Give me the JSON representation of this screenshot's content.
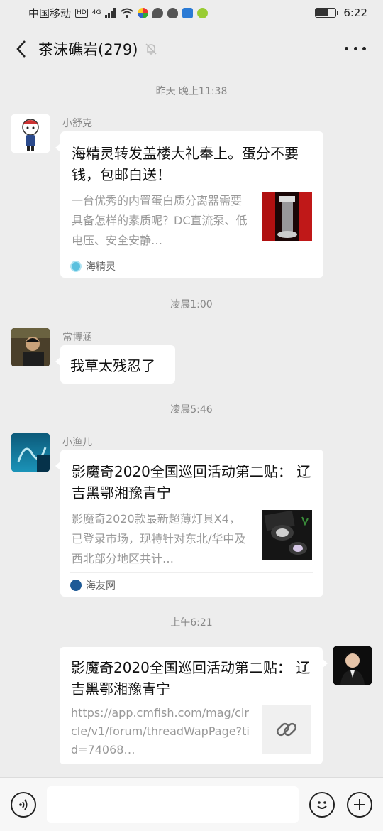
{
  "status_bar": {
    "carrier": "中国移动",
    "hd": "HD",
    "network": "4G",
    "time": "6:22",
    "battery_level": 0.55
  },
  "nav": {
    "title": "茶沫礁岩(279)",
    "back_icon": "chevron-left-icon",
    "mute_icon": "bell-off-icon",
    "more_icon": "more-dots-icon"
  },
  "messages": [
    {
      "timestamp": "昨天 晚上11:38",
      "sender": "小舒克",
      "type": "card",
      "title": "海精灵转发盖楼大礼奉上。蛋分不要钱，包邮白送！",
      "description": "一台优秀的内置蛋白质分离器需要具备怎样的素质呢？DC直流泵、低电压、安全安静…",
      "source": "海精灵"
    },
    {
      "timestamp": "凌晨1:00",
      "sender": "常博涵",
      "type": "text",
      "text": "我草太残忍了"
    },
    {
      "timestamp": "凌晨5:46",
      "sender": "小渔儿",
      "type": "card",
      "title": "影魔奇2020全国巡回活动第二贴： 辽吉黑鄂湘豫青宁",
      "description": "影魔奇2020款最新超薄灯具X4，已登录市场，现特针对东北/华中及西北部分地区共计…",
      "source": "海友网"
    },
    {
      "timestamp": "上午6:21",
      "sender": "",
      "type": "link",
      "title": "影魔奇2020全国巡回活动第二贴： 辽吉黑鄂湘豫青宁",
      "description": "https://app.cmfish.com/mag/circle/v1/forum/threadWapPage?tid=74068…"
    }
  ],
  "input_bar": {
    "placeholder": "",
    "voice_icon": "voice-icon",
    "emoji_icon": "emoji-icon",
    "plus_icon": "plus-icon"
  }
}
